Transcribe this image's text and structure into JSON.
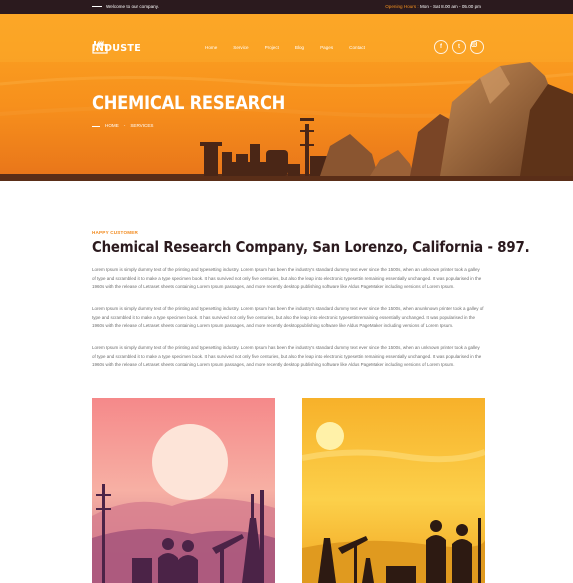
{
  "topbar": {
    "welcome": "Welcome to our company.",
    "hours_label": "Opening Hours :",
    "hours_value": "Mon - Sat 8.00 am - 05.00 pm"
  },
  "brand": {
    "name": "INDUSTE"
  },
  "nav": {
    "items": [
      "Home",
      "Service",
      "Project",
      "Blog",
      "Pages",
      "Contact"
    ]
  },
  "social": [
    "facebook-icon",
    "twitter-icon",
    "instagram-icon"
  ],
  "hero": {
    "title": "CHEMICAL RESEARCH",
    "breadcrumb": [
      "HOME",
      "SERVICES"
    ]
  },
  "content": {
    "kicker": "HAPPY CUSTOMER",
    "heading": "Chemical Research Company, San Lorenzo, California - 897.",
    "paragraphs": [
      "Lorem Ipsum is simply dummy text of the printing and typesetting industry. Lorem Ipsum has been the industry's standard dummy text ever since the 1500s, when an unknown printer took a galley of type and scrambled it to make a type specimen book. It has survived not only five centuries, but also the leap into electronic typesettin remaining essentially unchanged. It was popularised in the 1960s with the release of Letraset sheets containing Lorem Ipsum passages, and more recently desktop publishing software like Aldus PageMaker including versions of Lorem Ipsum.",
      "Lorem Ipsum is simply dummy text of the printing and typesetting industry. Lorem Ipsum has been the industry's standard dummy text ever since the 1500s, when anunknown printer took a galley of type and scrambled it to make a type specimen book. It has survived not only five centuries, but also the leap into electronic typesettinremaining essentially unchanged. It was popularised in the 1960s with the release of Letraset sheets containing Lorem Ipsum passages, and more recently desktoppublishing software like Aldus PageMaker including versions of Lorem Ipsum.",
      "Lorem Ipsum is simply dummy text of the printing and typesetting industry. Lorem Ipsum has been the industry's standard dummy text ever since the 1500s, when an unknown printer took a galley of type and scrambled it to make a type specimen book. It has survived not only five centuries, but also the leap into electronic typesettin remaining essentially unchanged. It was popularised in the 1960s with the release of Letraset sheets containing Lorem Ipsum passages, and more recently desktop publishing software like Aldus PageMaker including versions of Lorem Ipsum."
    ]
  },
  "colors": {
    "topbar": "#2b1a1e",
    "accent": "#f28a1d",
    "hero_orange": "#fb9a1f",
    "heading": "#2b1a1e"
  }
}
